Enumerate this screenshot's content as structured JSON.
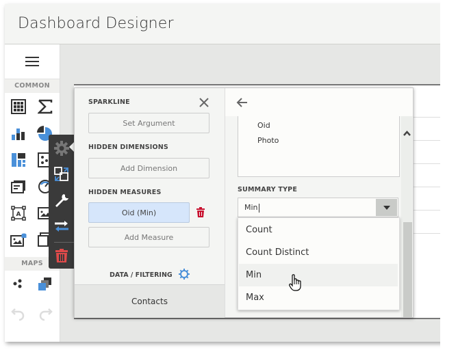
{
  "app": {
    "title": "Dashboard Designer"
  },
  "toolbox": {
    "menu_icon": "hamburger-icon",
    "groups": [
      {
        "label": "COMMON",
        "items": [
          "grid-icon",
          "pivot-sum-icon",
          "chart-icon",
          "pie-icon",
          "treemap-icon",
          "scatter-icon",
          "card-icon",
          "gauge-icon",
          "text-box-icon",
          "image-icon",
          "bound-image-icon",
          "group-icon"
        ]
      },
      {
        "label": "MAPS",
        "items": [
          "geo-point-map-icon",
          "choropleth-map-icon"
        ]
      }
    ],
    "undo_icon": "undo-icon",
    "redo_icon": "redo-icon"
  },
  "item_menu": {
    "items": [
      "bindings-gear-icon",
      "convert-icon",
      "options-wrench-icon",
      "interactivity-icon",
      "delete-trash-icon"
    ],
    "colors": {
      "accent": "#4a90d9",
      "danger": "#e04a4a"
    }
  },
  "binding_panel": {
    "sections": {
      "sparkline": {
        "label": "SPARKLINE",
        "button": "Set Argument"
      },
      "hidden_dimensions": {
        "label": "HIDDEN DIMENSIONS",
        "button": "Add Dimension"
      },
      "hidden_measures": {
        "label": "HIDDEN MEASURES",
        "selected": "Oid (Min)",
        "button": "Add Measure"
      }
    },
    "data_filtering": {
      "label": "DATA / FILTERING"
    },
    "bottom_tab": "Contacts"
  },
  "field_panel": {
    "fields": [
      "Oid",
      "Photo"
    ],
    "summary_type": {
      "label": "SUMMARY TYPE",
      "value": "Min",
      "options": [
        "Count",
        "Count Distinct",
        "Min",
        "Max"
      ],
      "hovered": "Min"
    }
  }
}
